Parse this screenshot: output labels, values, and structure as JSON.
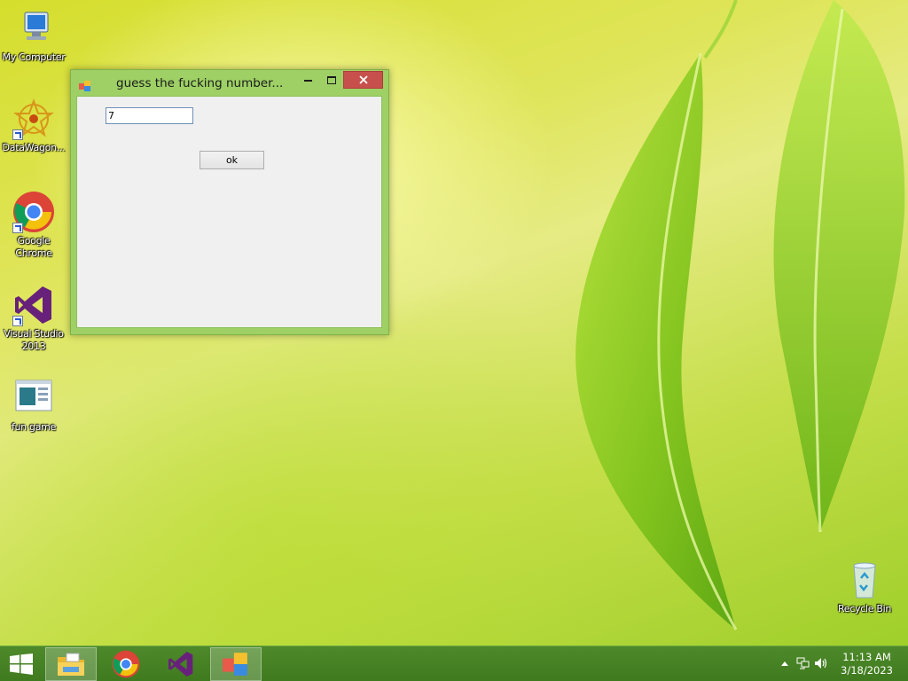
{
  "desktop": {
    "icons": [
      {
        "label": "My Computer"
      },
      {
        "label": "DataWagon..."
      },
      {
        "label": "Google Chrome"
      },
      {
        "label": "Visual Studio 2013"
      },
      {
        "label": "fun game"
      },
      {
        "label": "Recycle Bin"
      }
    ]
  },
  "window": {
    "title": "guess the fucking number...",
    "input_value": "7",
    "ok_label": "ok"
  },
  "taskbar": {
    "items": [
      "start-icon",
      "file-explorer-icon",
      "chrome-icon",
      "visual-studio-icon",
      "app-form-icon"
    ],
    "clock": {
      "time": "11:13 AM",
      "date": "3/18/2023"
    }
  },
  "colors": {
    "accent": "#9ed065",
    "close": "#c7504d",
    "taskbar": "#3f7a1f"
  }
}
